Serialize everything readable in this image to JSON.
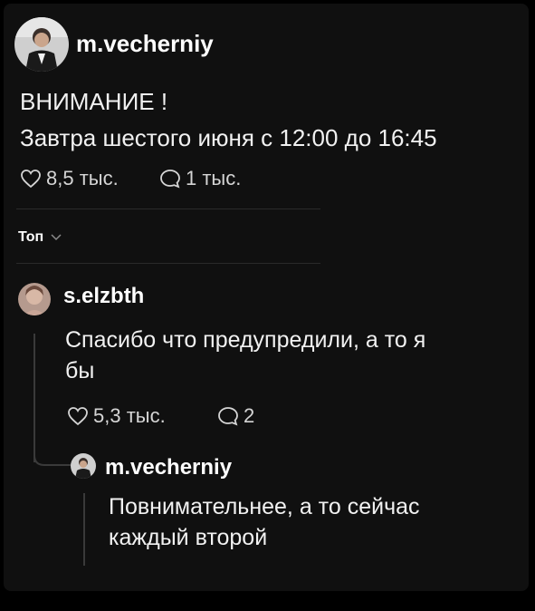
{
  "post": {
    "author": "m.vecherniy",
    "text_line1": "ВНИМАНИЕ !",
    "text_line2": "Завтра шестого июня с 12:00 до 16:45",
    "likes": "8,5 тыс.",
    "comments": "1 тыс."
  },
  "sort": {
    "label": "Топ"
  },
  "comment": {
    "author": "s.elzbth",
    "text": "Спасибо что предупредили, а то я бы",
    "likes": "5,3 тыс.",
    "replies": "2"
  },
  "reply": {
    "author": "m.vecherniy",
    "text": "Повнимательнее, а то сейчас каждый второй"
  },
  "colors": {
    "background": "#000000",
    "card": "#101010",
    "text": "#f1f1f1",
    "muted": "#d5d5d5",
    "thread_line": "#3a3a3a"
  }
}
